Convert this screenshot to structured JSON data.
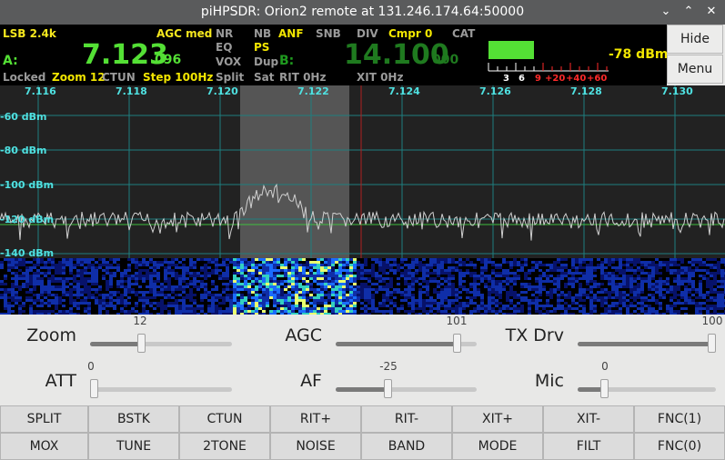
{
  "window": {
    "title": "piHPSDR: Orion2 remote at 131.246.174.64:50000",
    "minimize_glyph": "⌄",
    "maximize_glyph": "⌃",
    "close_glyph": "✕"
  },
  "vfo": {
    "mode": "LSB 2.4k",
    "agc": "AGC med",
    "a_label": "A:",
    "a_freq_main": "7.123",
    "a_freq_sub": "096",
    "b_label": "B:",
    "b_freq_main": "14.100",
    "b_freq_sub": "000",
    "locked": "Locked",
    "zoom": "Zoom 12",
    "ctun": "CTUN",
    "step": "Step 100Hz",
    "flags": {
      "nr": "NR",
      "nb": "NB",
      "anf": "ANF",
      "snb": "SNB",
      "div": "DIV",
      "cmpr": "Cmpr 0",
      "cat": "CAT",
      "eq": "EQ",
      "ps": "PS",
      "vox": "VOX",
      "dup": "Dup",
      "split": "Split",
      "sat": "Sat",
      "rit": "RIT 0Hz",
      "xit": "XIT 0Hz"
    },
    "smeter": {
      "reading": "-78 dBm",
      "scale": [
        "3",
        "6",
        "9",
        "+20",
        "+40",
        "+60"
      ],
      "level": 0.37,
      "colors": {
        "bar": "#54e035",
        "low": "#ffffff",
        "high": "#ff2a2a"
      }
    },
    "colors": {
      "a_freq": "#54e035",
      "b_freq": "#1f7a1f",
      "label_yellow": "#f2e600",
      "label_gray": "#9a9a9a",
      "mode_yellow": "#f6e81e"
    }
  },
  "side_buttons": {
    "hide": "Hide",
    "menu": "Menu"
  },
  "panadapter": {
    "freq_labels": [
      "7.116",
      "7.118",
      "7.120",
      "7.122",
      "7.124",
      "7.126",
      "7.128",
      "7.130"
    ],
    "db_labels": [
      "-60 dBm",
      "-80 dBm",
      "-100 dBm",
      "-120 dBm",
      "-140 dBm"
    ],
    "colors": {
      "grid": "#1e8a8a",
      "label": "#4fe1e1",
      "trace": "#cfcfcf",
      "passband": "#5a5a5a",
      "cursor": "#b02020",
      "noise_line": "#3fbf3f"
    }
  },
  "sliders": [
    {
      "label": "Zoom",
      "value": "12",
      "fraction": 0.36
    },
    {
      "label": "AGC",
      "value": "101",
      "fraction": 0.86
    },
    {
      "label": "TX Drv",
      "value": "100",
      "fraction": 0.99
    },
    {
      "label": "ATT",
      "value": "0",
      "fraction": 0.0
    },
    {
      "label": "AF",
      "value": "-25",
      "fraction": 0.37
    },
    {
      "label": "Mic",
      "value": "0",
      "fraction": 0.19
    }
  ],
  "buttons_row1": [
    "SPLIT",
    "BSTK",
    "CTUN",
    "RIT+",
    "RIT-",
    "XIT+",
    "XIT-",
    "FNC(1)"
  ],
  "buttons_row2": [
    "MOX",
    "TUNE",
    "2TONE",
    "NOISE",
    "BAND",
    "MODE",
    "FILT",
    "FNC(0)"
  ]
}
